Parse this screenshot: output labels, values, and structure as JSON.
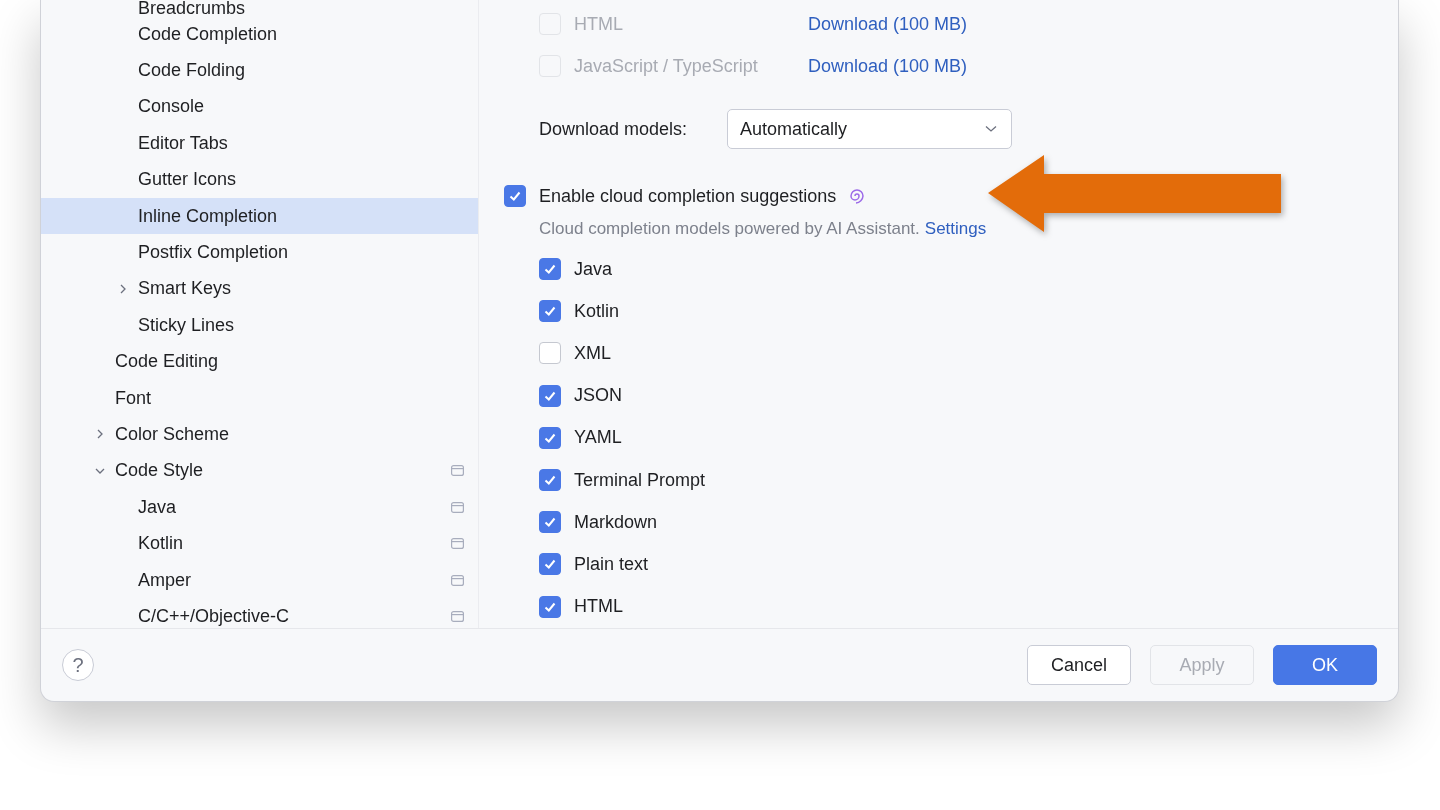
{
  "sidebar": {
    "nested_items": [
      {
        "label": "Breadcrumbs",
        "kind": "leaf",
        "selected": false,
        "scoped": false
      },
      {
        "label": "Code Completion",
        "kind": "leaf",
        "selected": false,
        "scoped": false
      },
      {
        "label": "Code Folding",
        "kind": "leaf",
        "selected": false,
        "scoped": false
      },
      {
        "label": "Console",
        "kind": "leaf",
        "selected": false,
        "scoped": false
      },
      {
        "label": "Editor Tabs",
        "kind": "leaf",
        "selected": false,
        "scoped": false
      },
      {
        "label": "Gutter Icons",
        "kind": "leaf",
        "selected": false,
        "scoped": false
      },
      {
        "label": "Inline Completion",
        "kind": "leaf",
        "selected": true,
        "scoped": false
      },
      {
        "label": "Postfix Completion",
        "kind": "leaf",
        "selected": false,
        "scoped": false
      },
      {
        "label": "Smart Keys",
        "kind": "group",
        "expanded": false,
        "selected": false,
        "scoped": false
      },
      {
        "label": "Sticky Lines",
        "kind": "leaf",
        "selected": false,
        "scoped": false
      }
    ],
    "items": [
      {
        "label": "Code Editing",
        "kind": "leaf",
        "selected": false,
        "scoped": false
      },
      {
        "label": "Font",
        "kind": "leaf",
        "selected": false,
        "scoped": false
      },
      {
        "label": "Color Scheme",
        "kind": "group",
        "expanded": false,
        "selected": false,
        "scoped": false
      },
      {
        "label": "Code Style",
        "kind": "group",
        "expanded": true,
        "selected": false,
        "scoped": true,
        "children": [
          {
            "label": "Java",
            "kind": "leaf",
            "selected": false,
            "scoped": true
          },
          {
            "label": "Kotlin",
            "kind": "leaf",
            "selected": false,
            "scoped": true
          },
          {
            "label": "Amper",
            "kind": "leaf",
            "selected": false,
            "scoped": true
          },
          {
            "label": "C/C++/Objective-C",
            "kind": "leaf",
            "selected": false,
            "scoped": true
          }
        ]
      }
    ]
  },
  "local_models": [
    {
      "label": "HTML",
      "checked": false,
      "disabled": true,
      "link": "Download (100 MB)"
    },
    {
      "label": "JavaScript / TypeScript",
      "checked": false,
      "disabled": true,
      "link": "Download (100 MB)"
    }
  ],
  "download_models": {
    "label": "Download models:",
    "value": "Automatically"
  },
  "cloud_completion": {
    "label": "Enable cloud completion suggestions",
    "checked": true,
    "hint": "Cloud completion models powered by AI Assistant.",
    "hint_link": "Settings"
  },
  "cloud_languages": [
    {
      "label": "Java",
      "checked": true
    },
    {
      "label": "Kotlin",
      "checked": true
    },
    {
      "label": "XML",
      "checked": false
    },
    {
      "label": "JSON",
      "checked": true
    },
    {
      "label": "YAML",
      "checked": true
    },
    {
      "label": "Terminal Prompt",
      "checked": true
    },
    {
      "label": "Markdown",
      "checked": true
    },
    {
      "label": "Plain text",
      "checked": true
    },
    {
      "label": "HTML",
      "checked": true
    }
  ],
  "help_button": {
    "label": "?"
  },
  "buttons": [
    {
      "label": "Cancel",
      "kind": "secondary",
      "disabled": false
    },
    {
      "label": "Apply",
      "kind": "secondary",
      "disabled": true
    },
    {
      "label": "OK",
      "kind": "primary",
      "disabled": false
    }
  ]
}
